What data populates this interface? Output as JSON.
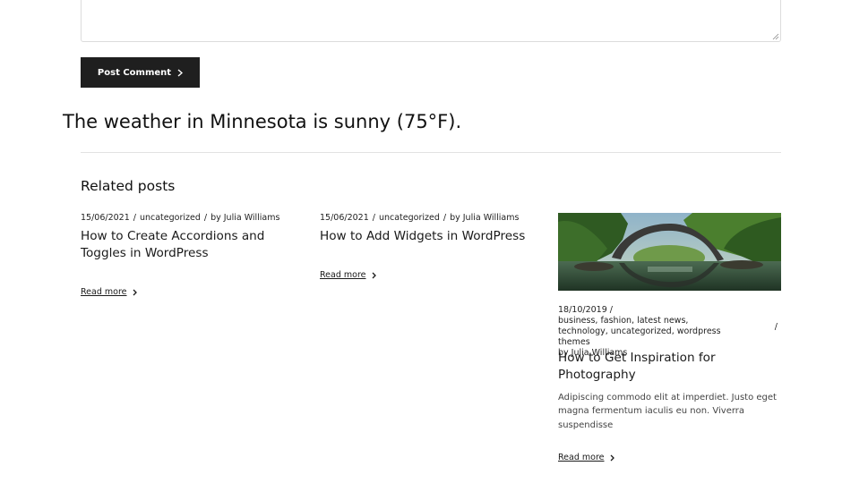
{
  "comment_form": {
    "submit_label": "Post Comment"
  },
  "weather": {
    "text": "The weather in Minnesota is sunny (75°F)."
  },
  "related": {
    "heading": "Related posts",
    "posts": [
      {
        "date": "15/06/2021",
        "categories": "uncategorized",
        "author": "by Julia Williams",
        "title": "How to Create Accordions and Toggles in WordPress",
        "read_more": "Read more"
      },
      {
        "date": "15/06/2021",
        "categories": "uncategorized",
        "author": "by Julia Williams",
        "title": "How to Add Widgets in WordPress",
        "read_more": "Read more"
      },
      {
        "date": "18/10/2019",
        "categories": "business, fashion, latest news, technology, uncategorized, wordpress themes",
        "author": "by Julia Williams",
        "title": "How to Get Inspiration for Photography",
        "excerpt": "Adipiscing commodo elit at imperdiet. Justo eget magna fermentum iaculis eu non. Viverra suspendisse",
        "read_more": "Read more",
        "image_alt": "stone-arch-bridge-photo"
      }
    ],
    "separator": "/"
  }
}
